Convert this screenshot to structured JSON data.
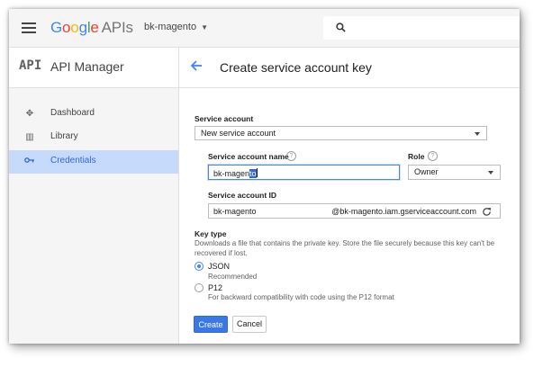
{
  "header": {
    "logo_letters": [
      "G",
      "o",
      "o",
      "g",
      "l",
      "e"
    ],
    "logo_suffix": "APIs",
    "project": "bk-magento"
  },
  "sidebar": {
    "app_mark": "API",
    "app_title": "API Manager",
    "items": [
      {
        "label": "Dashboard",
        "icon": "dashboard-icon"
      },
      {
        "label": "Library",
        "icon": "library-icon"
      },
      {
        "label": "Credentials",
        "icon": "key-icon",
        "active": true
      }
    ]
  },
  "main": {
    "title": "Create service account key",
    "service_account_label": "Service account",
    "service_account_value": "New service account",
    "name_label": "Service account name",
    "name_value_prefix": "bk-magen",
    "name_value_selected": "to",
    "role_label": "Role",
    "role_value": "Owner",
    "id_label": "Service account ID",
    "id_value": "bk-magento",
    "id_suffix": "@bk-magento.iam.gserviceaccount.com",
    "key_type_label": "Key type",
    "key_type_desc": "Downloads a file that contains the private key. Store the file securely because this key can't be recovered if lost.",
    "options": [
      {
        "label": "JSON",
        "sub": "Recommended",
        "selected": true
      },
      {
        "label": "P12",
        "sub": "For backward compatibility with code using the P12 format",
        "selected": false
      }
    ],
    "create_label": "Create",
    "cancel_label": "Cancel"
  },
  "colors": {
    "accent": "#4285f4",
    "active_nav_bg": "#c6dafc",
    "primary_button": "#3b78e7"
  }
}
